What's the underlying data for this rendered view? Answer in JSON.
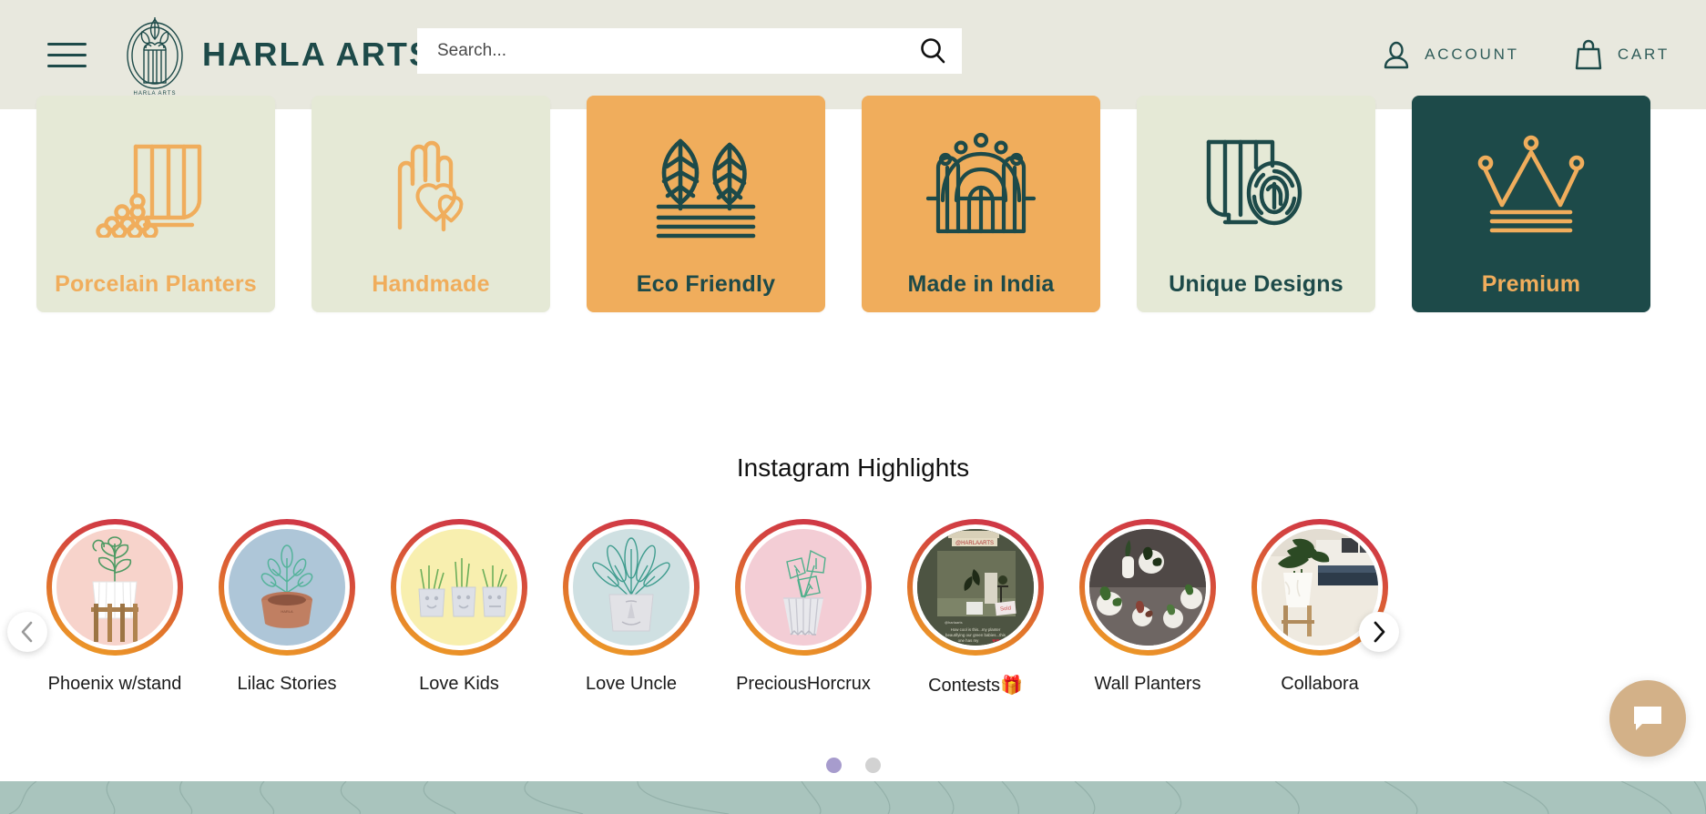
{
  "header": {
    "menu_icon": "hamburger-icon",
    "brand_name": "HARLA ARTS",
    "logo_alt": "harla-arts-logo",
    "search": {
      "placeholder": "Search...",
      "value": "",
      "icon": "search-icon"
    },
    "account": {
      "label": "ACCOUNT",
      "icon": "user-icon"
    },
    "cart": {
      "label": "CART",
      "icon": "shopping-bag-icon"
    }
  },
  "feature_cards": [
    {
      "label": "Porcelain Planters",
      "icon": "porcelain-planters-icon",
      "bg": "#e5e9d6",
      "fg": "#f0ad5c"
    },
    {
      "label": "Handmade",
      "icon": "handmade-hand-heart-icon",
      "bg": "#e5e9d6",
      "fg": "#f0ad5c"
    },
    {
      "label": "Eco Friendly",
      "icon": "eco-friendly-leaves-icon",
      "bg": "#f0ad5c",
      "fg": "#1d4a49"
    },
    {
      "label": "Made in India",
      "icon": "made-in-india-monument-icon",
      "bg": "#f0ad5c",
      "fg": "#1d4a49"
    },
    {
      "label": "Unique Designs",
      "icon": "unique-designs-fingerprint-icon",
      "bg": "#e5e9d6",
      "fg": "#1d4a49"
    },
    {
      "label": "Premium",
      "icon": "premium-crown-icon",
      "bg": "#1d4a49",
      "fg": "#f0ad5c"
    }
  ],
  "instagram": {
    "title": "Instagram Highlights",
    "prev_icon": "chevron-left-icon",
    "next_icon": "chevron-right-icon",
    "ring_gradient_from": "#f0a427",
    "ring_gradient_to": "#cc2f4a",
    "highlights": [
      {
        "label": "Phoenix w/stand",
        "thumb_bg": "#f7d3cb",
        "thumb": "white-fluted-planter-on-wood-stand"
      },
      {
        "label": "Lilac Stories",
        "thumb_bg": "#aec6d8",
        "thumb": "terracotta-round-planter"
      },
      {
        "label": "Love Kids",
        "thumb_bg": "#f8efaf",
        "thumb": "three-face-planters"
      },
      {
        "label": "Love Uncle",
        "thumb_bg": "#cfe0e2",
        "thumb": "face-planter-with-leaves"
      },
      {
        "label": "PreciousHorcrux",
        "thumb_bg": "#f3cdd5",
        "thumb": "faceted-white-planter"
      },
      {
        "label": "Contests🎁",
        "thumb_bg": "#4d5442",
        "thumb": "contest-post-screenshot"
      },
      {
        "label": "Wall Planters",
        "thumb_bg": "#6b6360",
        "thumb": "wall-mounted-planters-photo"
      },
      {
        "label": "Collabora",
        "thumb_bg": "#e9e3d8",
        "thumb": "living-room-plant-photo"
      }
    ],
    "pagination": {
      "active_index": 0,
      "count": 2,
      "active_color": "#a79ccd",
      "inactive_color": "#d2d2d2"
    }
  },
  "chat": {
    "icon": "chat-bubble-icon",
    "color": "#d3b188"
  },
  "footer_band": {
    "color": "#a9c4bd"
  },
  "theme": {
    "header_bg": "#e8e8de",
    "dark_green": "#1d4a49",
    "accent_orange": "#f0ad5c",
    "light_sage": "#e5e9d6"
  }
}
